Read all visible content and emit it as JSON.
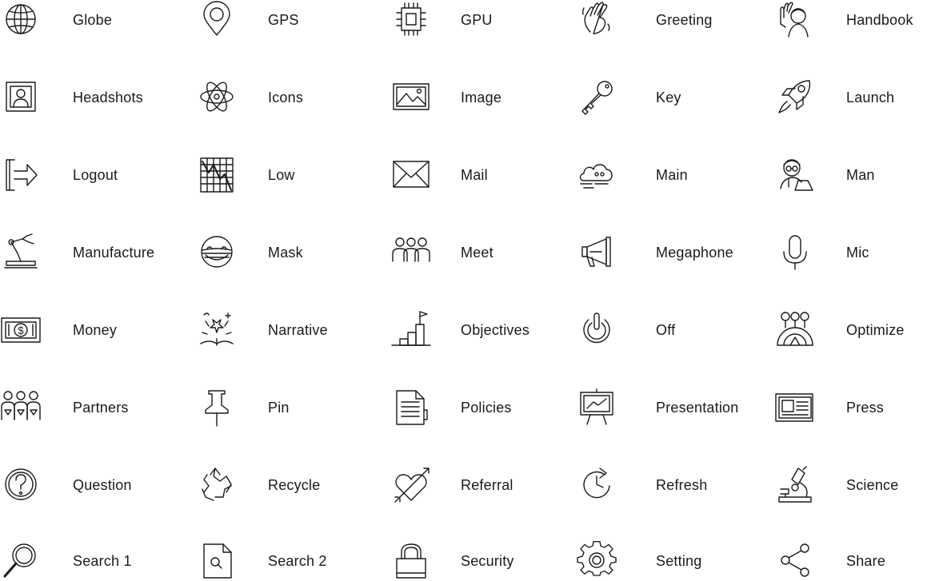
{
  "icons": [
    {
      "label": "Globe",
      "icon": "globe-icon"
    },
    {
      "label": "GPS",
      "icon": "gps-icon"
    },
    {
      "label": "GPU",
      "icon": "gpu-icon"
    },
    {
      "label": "Greeting",
      "icon": "greeting-icon"
    },
    {
      "label": "Handbook",
      "icon": "handbook-icon"
    },
    {
      "label": "Headshots",
      "icon": "headshots-icon"
    },
    {
      "label": "Icons",
      "icon": "icons-icon"
    },
    {
      "label": "Image",
      "icon": "image-icon"
    },
    {
      "label": "Key",
      "icon": "key-icon"
    },
    {
      "label": "Launch",
      "icon": "launch-icon"
    },
    {
      "label": "Logout",
      "icon": "logout-icon"
    },
    {
      "label": "Low",
      "icon": "low-icon"
    },
    {
      "label": "Mail",
      "icon": "mail-icon"
    },
    {
      "label": "Main",
      "icon": "main-icon"
    },
    {
      "label": "Man",
      "icon": "man-icon"
    },
    {
      "label": "Manufacture",
      "icon": "manufacture-icon"
    },
    {
      "label": "Mask",
      "icon": "mask-icon"
    },
    {
      "label": "Meet",
      "icon": "meet-icon"
    },
    {
      "label": "Megaphone",
      "icon": "megaphone-icon"
    },
    {
      "label": "Mic",
      "icon": "mic-icon"
    },
    {
      "label": "Money",
      "icon": "money-icon"
    },
    {
      "label": "Narrative",
      "icon": "narrative-icon"
    },
    {
      "label": "Objectives",
      "icon": "objectives-icon"
    },
    {
      "label": "Off",
      "icon": "off-icon"
    },
    {
      "label": "Optimize",
      "icon": "optimize-icon"
    },
    {
      "label": "Partners",
      "icon": "partners-icon"
    },
    {
      "label": "Pin",
      "icon": "pin-icon"
    },
    {
      "label": "Policies",
      "icon": "policies-icon"
    },
    {
      "label": "Presentation",
      "icon": "presentation-icon"
    },
    {
      "label": "Press",
      "icon": "press-icon"
    },
    {
      "label": "Question",
      "icon": "question-icon"
    },
    {
      "label": "Recycle",
      "icon": "recycle-icon"
    },
    {
      "label": "Referral",
      "icon": "referral-icon"
    },
    {
      "label": "Refresh",
      "icon": "refresh-icon"
    },
    {
      "label": "Science",
      "icon": "science-icon"
    },
    {
      "label": "Search 1",
      "icon": "search-1-icon"
    },
    {
      "label": "Search 2",
      "icon": "search-2-icon"
    },
    {
      "label": "Security",
      "icon": "security-icon"
    },
    {
      "label": "Setting",
      "icon": "setting-icon"
    },
    {
      "label": "Share",
      "icon": "share-icon"
    }
  ],
  "colors": {
    "stroke": "#1a1a1a",
    "background": "#ffffff"
  }
}
